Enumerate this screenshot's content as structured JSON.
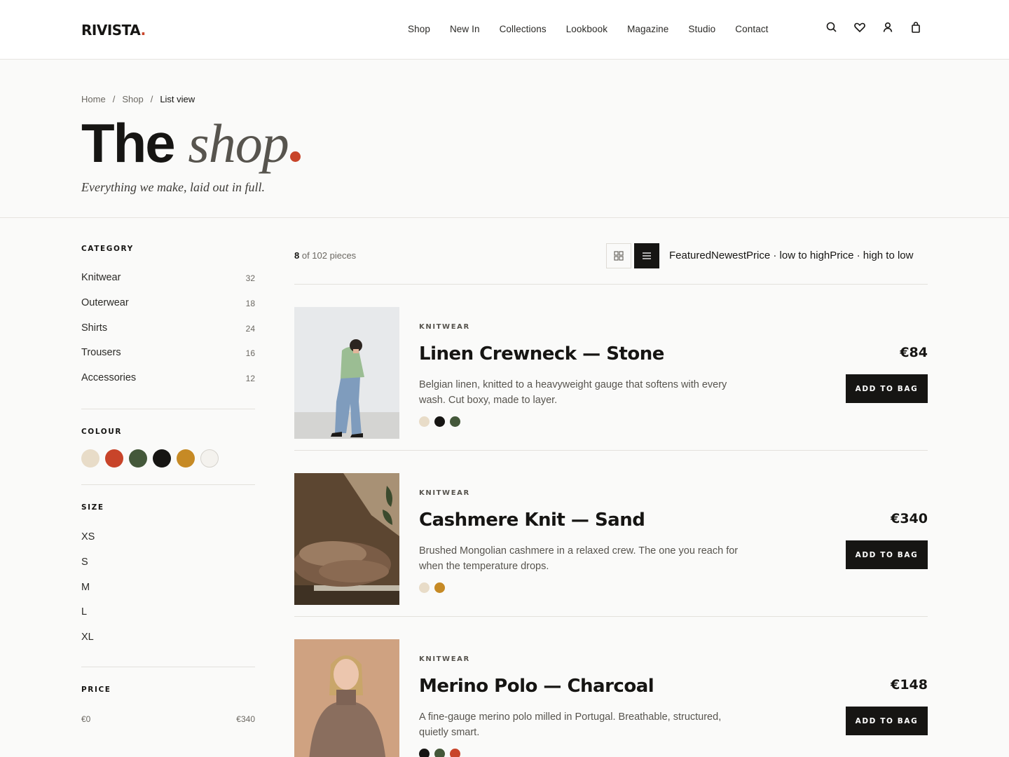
{
  "brand": {
    "name": "RIVISTA",
    "dot": ".",
    "accent": "#c8442a"
  },
  "nav": [
    "Shop",
    "New In",
    "Collections",
    "Lookbook",
    "Magazine",
    "Studio",
    "Contact"
  ],
  "header_icons": [
    "search-icon",
    "heart-icon",
    "user-icon",
    "bag-icon"
  ],
  "breadcrumb": {
    "home": "Home",
    "shop": "Shop",
    "current": "List view",
    "separator": "/"
  },
  "hero": {
    "title_main": "The",
    "title_italic": "shop",
    "subtitle": "Everything we make, laid out in full."
  },
  "filters": {
    "category": {
      "title": "CATEGORY",
      "items": [
        {
          "label": "Knitwear",
          "count": "32"
        },
        {
          "label": "Outerwear",
          "count": "18"
        },
        {
          "label": "Shirts",
          "count": "24"
        },
        {
          "label": "Trousers",
          "count": "16"
        },
        {
          "label": "Accessories",
          "count": "12"
        }
      ]
    },
    "colour": {
      "title": "COLOUR",
      "swatches": [
        "#e8dcc8",
        "#c8442a",
        "#44583a",
        "#161513",
        "#c68a25",
        "#f4f2ee"
      ]
    },
    "size": {
      "title": "SIZE",
      "items": [
        "XS",
        "S",
        "M",
        "L",
        "XL"
      ]
    },
    "price": {
      "title": "PRICE",
      "min": "€0",
      "max": "€340"
    }
  },
  "toolbar": {
    "count_shown": "8",
    "count_rest": " of 102 pieces",
    "sort_options": "FeaturedNewestPrice · low to highPrice · high to low"
  },
  "products": [
    {
      "category": "KNITWEAR",
      "name": "Linen Crewneck — Stone",
      "description": "Belgian linen, knitted to a heavyweight gauge that softens with every wash. Cut boxy, made to layer.",
      "colors": [
        "#e8dcc8",
        "#161513",
        "#44583a"
      ],
      "price": "€84",
      "button": "ADD TO BAG"
    },
    {
      "category": "KNITWEAR",
      "name": "Cashmere Knit — Sand",
      "description": "Brushed Mongolian cashmere in a relaxed crew. The one you reach for when the temperature drops.",
      "colors": [
        "#e8dcc8",
        "#c68a25"
      ],
      "price": "€340",
      "button": "ADD TO BAG"
    },
    {
      "category": "KNITWEAR",
      "name": "Merino Polo — Charcoal",
      "description": "A fine-gauge merino polo milled in Portugal. Breathable, structured, quietly smart.",
      "colors": [
        "#161513",
        "#44583a",
        "#c8442a"
      ],
      "price": "€148",
      "button": "ADD TO BAG"
    }
  ]
}
